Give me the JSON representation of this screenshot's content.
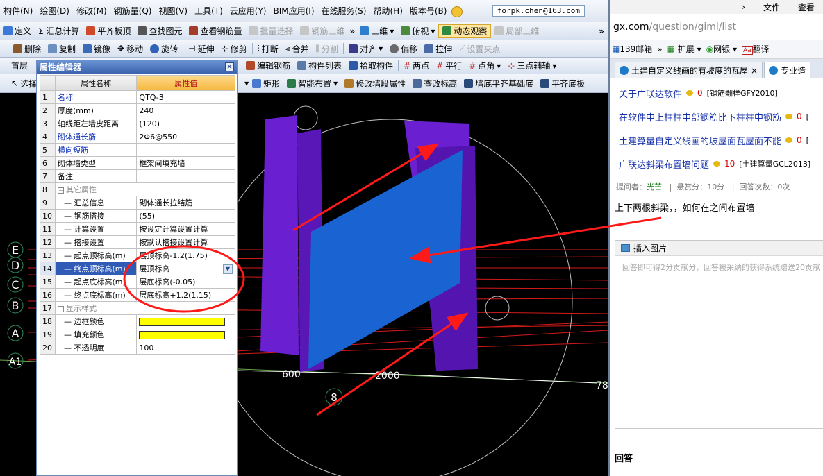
{
  "menubar": {
    "items": [
      "构件(N)",
      "绘图(D)",
      "修改(M)",
      "钢筋量(Q)",
      "视图(V)",
      "工具(T)",
      "云应用(Y)",
      "BIM应用(I)",
      "在线服务(S)",
      "帮助(H)",
      "版本号(B)"
    ],
    "email": "forpk.chen@163.com"
  },
  "toolbar1": {
    "define": "定义",
    "summary": "Σ 汇总计算",
    "level_slab": "平齐板顶",
    "find_elem": "查找图元",
    "view_rebar": "查看钢筋量",
    "batch_select": "批量选择",
    "rebar_3d": "钢筋三维",
    "view_3d": "三维",
    "top_view": "俯视",
    "dynamic_view": "动态观察",
    "local_3d": "局部三维"
  },
  "toolbar2": {
    "delete": "删除",
    "copy": "复制",
    "mirror": "镜像",
    "move": "移动",
    "rotate": "旋转",
    "extend": "延伸",
    "trim": "修剪",
    "break": "打断",
    "merge": "合并",
    "split": "分割",
    "align": "对齐",
    "offset": "偏移",
    "stretch": "拉伸",
    "set_grip": "设置夹点"
  },
  "toolbar3": {
    "floor": "首层",
    "edit_rebar": "编辑钢筋",
    "elem_list": "构件列表",
    "pick_elem": "拾取构件",
    "two_points": "两点",
    "parallel": "平行",
    "point_angle": "点角",
    "three_point_aux": "三点辅轴"
  },
  "toolbar4": {
    "select": "选择",
    "rect": "矩形",
    "smart_layout": "智能布置",
    "modify_seg": "修改墙段属性",
    "check_elev": "查改标高",
    "wall_bottom": "墙底平齐基础底",
    "level_bottom": "平齐底板"
  },
  "prop_editor": {
    "title": "属性编辑器",
    "col_name": "属性名称",
    "col_value": "属性值",
    "rows": [
      {
        "num": "1",
        "name": "名称",
        "value": "QTQ-3"
      },
      {
        "num": "2",
        "name": "厚度(mm)",
        "value": "240"
      },
      {
        "num": "3",
        "name": "轴线距左墙皮距离",
        "value": "(120)"
      },
      {
        "num": "4",
        "name": "砌体通长筋",
        "value": "2Φ6@550"
      },
      {
        "num": "5",
        "name": "横向短筋",
        "value": ""
      },
      {
        "num": "6",
        "name": "砌体墙类型",
        "value": "框架间填充墙"
      },
      {
        "num": "7",
        "name": "备注",
        "value": ""
      },
      {
        "num": "8",
        "name": "其它属性",
        "value": ""
      },
      {
        "num": "9",
        "name": "汇总信息",
        "value": "砌体通长拉结筋"
      },
      {
        "num": "10",
        "name": "钢筋搭接",
        "value": "(55)"
      },
      {
        "num": "11",
        "name": "计算设置",
        "value": "按设定计算设置计算"
      },
      {
        "num": "12",
        "name": "搭接设置",
        "value": "按默认搭接设置计算"
      },
      {
        "num": "13",
        "name": "起点顶标高(m)",
        "value": "层顶标高-1.2(1.75)"
      },
      {
        "num": "14",
        "name": "终点顶标高(m)",
        "value": "层顶标高"
      },
      {
        "num": "15",
        "name": "起点底标高(m)",
        "value": "层底标高(-0.05)"
      },
      {
        "num": "16",
        "name": "终点底标高(m)",
        "value": "层底标高+1.2(1.15)"
      },
      {
        "num": "17",
        "name": "显示样式",
        "value": ""
      },
      {
        "num": "18",
        "name": "边框颜色",
        "value": ""
      },
      {
        "num": "19",
        "name": "填充颜色",
        "value": ""
      },
      {
        "num": "20",
        "name": "不透明度",
        "value": "100"
      }
    ]
  },
  "viewport": {
    "axis_labels": [
      "E",
      "D",
      "C",
      "B",
      "A",
      "A1"
    ],
    "dim_600": "600",
    "dim_2000": "2000",
    "dim_78": "78",
    "axis_8": "8",
    "colors": {
      "wall_purple": "#6a1fd0",
      "wall_blue": "#1a63d2",
      "annot_red": "#ff1a1a",
      "fill_yellow": "#ffff00"
    }
  },
  "browser": {
    "menu_file": "文件",
    "menu_view": "查看",
    "url_domain": "gx.com",
    "url_path": "/question/giml/list",
    "bm_mail": "139邮箱",
    "bm_ext": "扩展",
    "bm_bank": "网银",
    "bm_translate": "翻译",
    "tab1": "土建自定义线画的有坡度的瓦屋",
    "tab2": "专业造",
    "questions": [
      {
        "title": "关于广联达软件",
        "score": "0",
        "cat": "[钢筋翻样GFY2010]"
      },
      {
        "title": "在软件中上柱柱中部钢筋比下柱柱中钢筋",
        "score": "0",
        "cat": "["
      },
      {
        "title": "土建算量自定义线画的坡屋面瓦屋面不能",
        "score": "0",
        "cat": "["
      },
      {
        "title": "广联达斜梁布置墙问题",
        "score": "10",
        "cat": "[土建算量GCL2013]"
      }
    ],
    "meta_asker_label": "提问者：",
    "meta_asker": "光芒",
    "meta_reward": "悬赏分：10分",
    "meta_answers": "回答次数：0次",
    "question_body": "上下两根斜梁，，如何在之间布置墙",
    "insert_image": "插入图片",
    "editor_placeholder": "回答即可得2分贡献分，回答被采纳的获得系统赠送20贡献",
    "answer_label": "回答"
  }
}
